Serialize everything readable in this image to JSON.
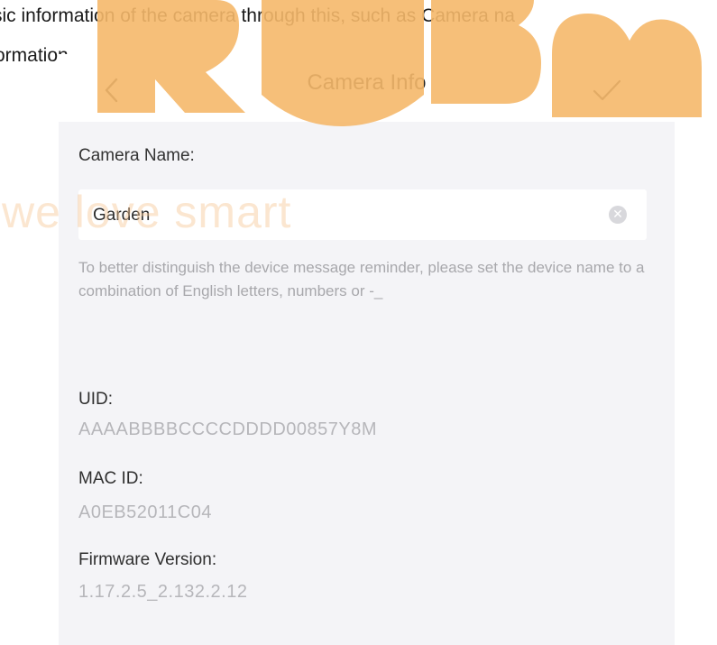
{
  "document": {
    "line1": "sic information of the camera through this, such as Camera na",
    "line2": "ormation."
  },
  "navbar": {
    "title": "Camera Info",
    "back_icon": "chevron-left-icon",
    "confirm_icon": "checkmark-icon"
  },
  "camera_name": {
    "label": "Camera Name:",
    "value": "Garden",
    "clear_icon": "clear-icon",
    "hint": "To better distinguish the device message reminder, please set the device name to a combination of English letters, numbers or -_"
  },
  "info": {
    "uid_label": "UID:",
    "uid_value": "AAAABBBBCCCCDDDD00857Y8M",
    "mac_label": "MAC ID:",
    "mac_value": "A0EB52011C04",
    "firmware_label": "Firmware Version:",
    "firmware_value": "1.17.2.5_2.132.2.12"
  },
  "watermark": {
    "logo_text": "ROBB",
    "tagline": "we love smart",
    "color": "#f5b86a"
  }
}
